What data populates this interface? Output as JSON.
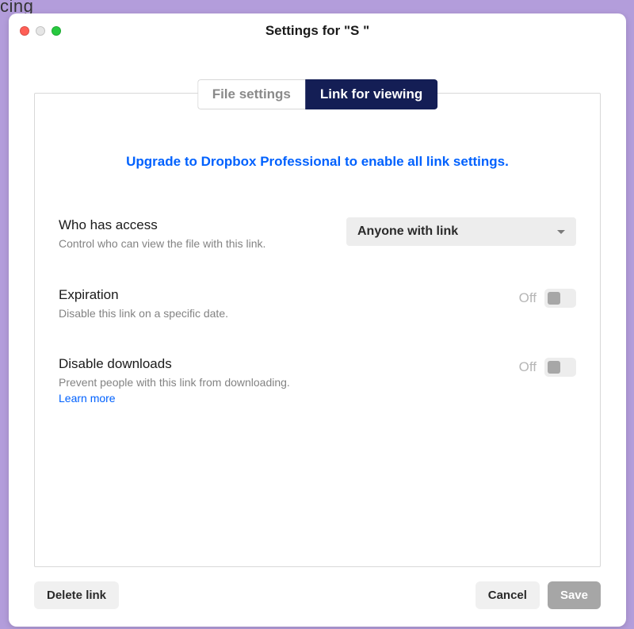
{
  "background_text": "cing",
  "window_title": "Settings for \"S                                         \"",
  "tabs": {
    "file_settings": "File settings",
    "link_for_viewing": "Link for viewing"
  },
  "upsell": "Upgrade to Dropbox Professional to enable all link settings.",
  "settings": {
    "access": {
      "title": "Who has access",
      "desc": "Control who can view the file with this link.",
      "dropdown_value": "Anyone with link"
    },
    "expiration": {
      "title": "Expiration",
      "desc": "Disable this link on a specific date.",
      "state": "Off"
    },
    "disable_downloads": {
      "title": "Disable downloads",
      "desc": "Prevent people with this link from downloading. ",
      "learn_more": "Learn more",
      "state": "Off"
    }
  },
  "footer": {
    "delete_link": "Delete link",
    "cancel": "Cancel",
    "save": "Save"
  }
}
